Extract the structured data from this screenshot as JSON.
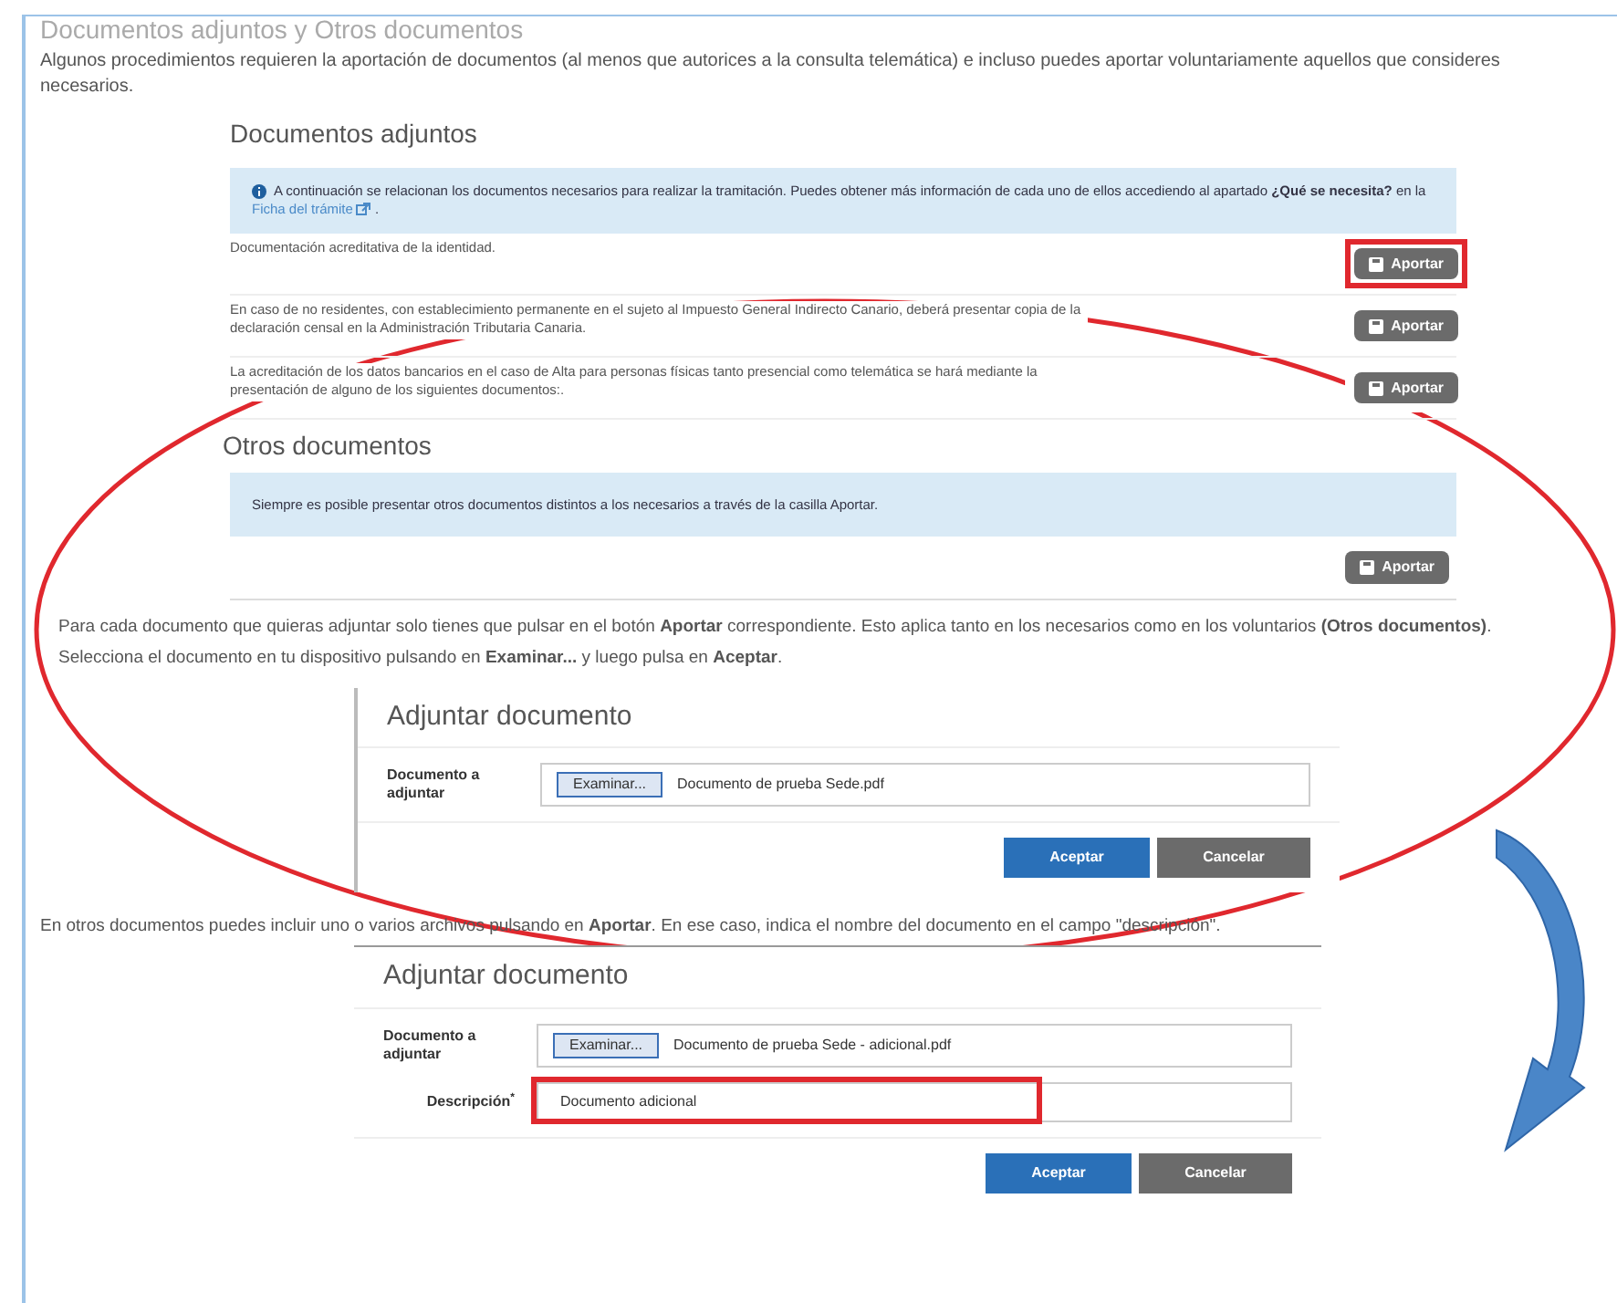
{
  "title": "Documentos adjuntos y Otros documentos",
  "intro": "Algunos procedimientos requieren la aportación de documentos (al menos que autorices a la consulta telemática) e incluso puedes aportar voluntariamente aquellos que consideres necesarios.",
  "attached": {
    "heading": "Documentos adjuntos",
    "info": "A continuación se relacionan los documentos necesarios para realizar la tramitación. Puedes obtener más información de cada uno de ellos accediendo al apartado **¿Qué se necesita?** en la",
    "info_link": "Ficha del trámite",
    "info_end": ".",
    "documents": [
      {
        "text": "Documentación acreditativa de la identidad.",
        "button": "Aportar",
        "highlighted": true
      },
      {
        "text": "En caso de no residentes, con establecimiento permanente en el sujeto al Impuesto General Indirecto Canario, deberá presentar copia de la declaración censal en la Administración Tributaria Canaria.",
        "button": "Aportar",
        "highlighted": false
      },
      {
        "text": "La acreditación de los datos bancarios en el caso de Alta para personas físicas tanto presencial como telemática se hará mediante la presentación de alguno de los siguientes documentos:.",
        "button": "Aportar",
        "highlighted": false
      }
    ]
  },
  "others": {
    "heading": "Otros documentos",
    "info": "Siempre es posible presentar otros documentos distintos a los necesarios a través de la casilla Aportar.",
    "button": "Aportar"
  },
  "step1": "Para cada documento que quieras adjuntar solo tienes que pulsar en el botón **Aportar** correspondiente. Esto aplica tanto en los necesarios como en los voluntarios **(Otros documentos)**.",
  "step2": "Selecciona el documento en tu dispositivo pulsando en **Examinar...** y luego pulsa en **Aceptar**.",
  "dialog1": {
    "title": "Adjuntar documento",
    "file_label": "Documento a adjuntar",
    "browse": "Examinar...",
    "file": "Documento de prueba Sede.pdf",
    "ok": "Aceptar",
    "cancel": "Cancelar"
  },
  "step3": "En otros documentos puedes incluir uno o varios archivos pulsando en **Aportar**. En ese caso, indica el nombre del documento en el campo \"descripción\".",
  "dialog2": {
    "title": "Adjuntar documento",
    "file_label": "Documento a adjuntar",
    "browse": "Examinar...",
    "file": "Documento de prueba Sede - adicional.pdf",
    "description_label": "Descripción$^{*}$",
    "description": "Documento adicional",
    "description_highlighted": true,
    "ok": "Aceptar",
    "cancel": "Cancelar"
  }
}
